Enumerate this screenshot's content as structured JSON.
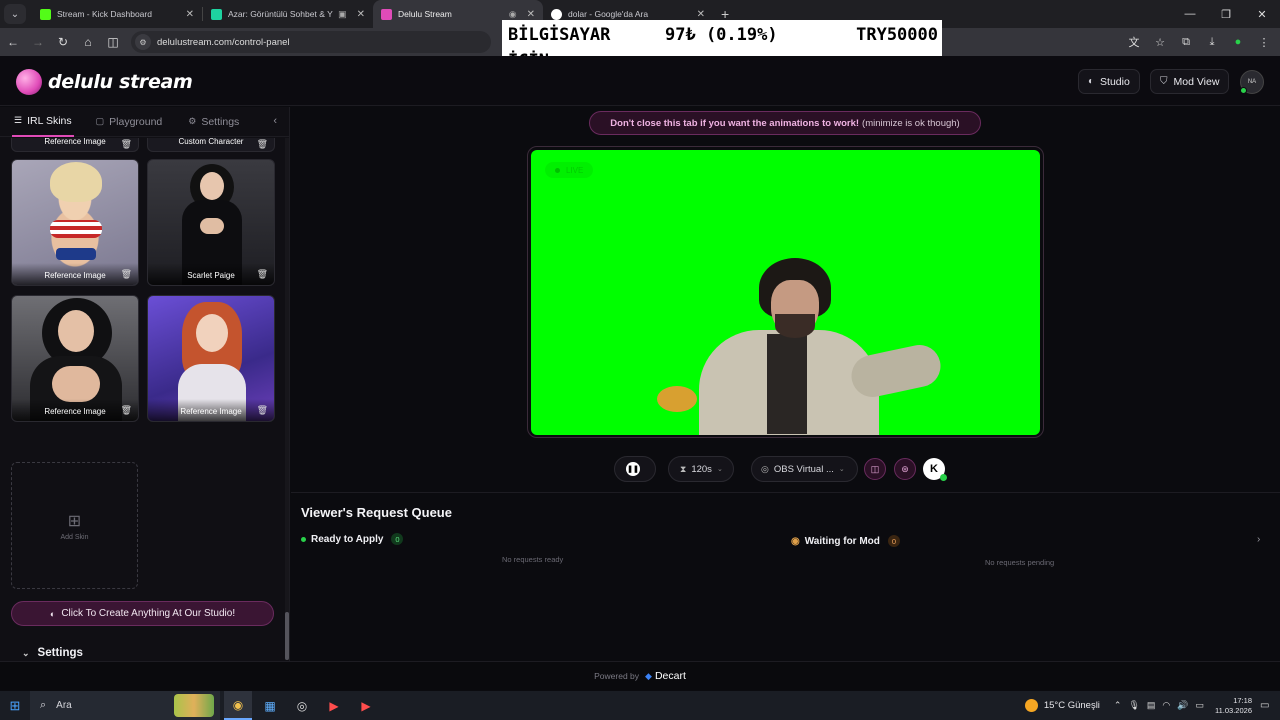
{
  "browser": {
    "tabs": [
      {
        "title": "Stream - Kick Dashboard",
        "favicon_color": "#53fc18"
      },
      {
        "title": "Azar: Görüntülü Sohbet & Y",
        "favicon_color": "#1ed3a0"
      },
      {
        "title": "Delulu Stream",
        "favicon_color": "#e04bb8"
      },
      {
        "title": "dolar - Google'da Ara",
        "favicon_color": "#ffffff"
      }
    ],
    "url": "delulustream.com/control-panel"
  },
  "ticker": {
    "label_line1": "BİLGİSAYAR",
    "label_line2": "İÇİN",
    "price": "97₺ (0.19%)",
    "total": "TRY50000"
  },
  "header": {
    "logo_text": "delulu stream",
    "studio_label": "Studio",
    "modview_label": "Mod View",
    "avatar_alt": "NA"
  },
  "sidebar": {
    "tabs": [
      "IRL Skins",
      "Playground",
      "Settings"
    ],
    "top_partial": [
      "Reference Image",
      "Custom Character"
    ],
    "skins": [
      "Reference Image",
      "Scarlet Paige",
      "Reference Image",
      "Reference Image"
    ],
    "add_skin_label": "Add Skin",
    "studio_cta": "Click To Create Anything At Our Studio!",
    "settings_label": "Settings"
  },
  "main": {
    "notice_bold": "Don't close this tab if you want the animations to work!",
    "notice_rest": "(minimize is ok though)",
    "preview_badge": "LIVE",
    "duration_label": "120s",
    "camera_label": "OBS Virtual ...",
    "queue_title": "Viewer's Request Queue",
    "ready": {
      "label": "Ready to Apply",
      "count": "0",
      "empty": "No requests ready"
    },
    "waiting": {
      "label": "Waiting for Mod",
      "count": "0",
      "empty": "No requests pending"
    }
  },
  "footer": {
    "powered_by": "Powered by",
    "brand": "Decart"
  },
  "taskbar": {
    "search_placeholder": "Ara",
    "weather": "15°C  Güneşli",
    "time": "17:18",
    "date": "11.03.2026"
  },
  "colors": {
    "accent": "#e04bb8",
    "greenscreen": "#00ff00",
    "ready": "#29d14a",
    "waiting": "#e0a04a"
  }
}
